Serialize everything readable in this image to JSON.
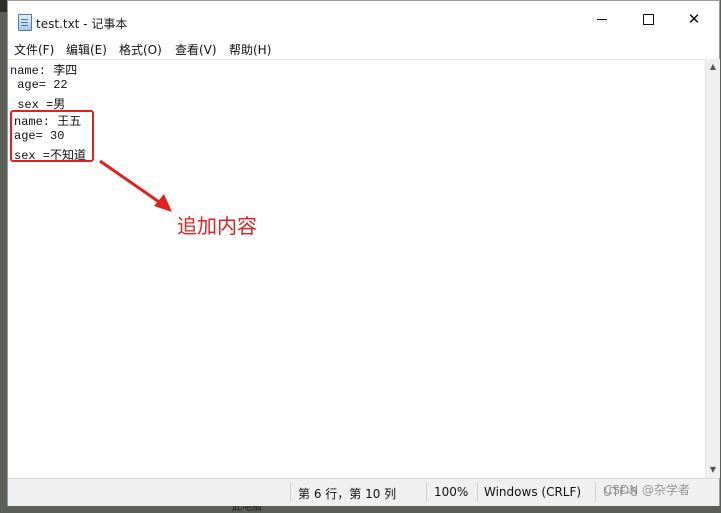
{
  "window": {
    "title": "test.txt - 记事本"
  },
  "menu": {
    "items": [
      "文件(F)",
      "编辑(E)",
      "格式(O)",
      "查看(V)",
      "帮助(H)"
    ]
  },
  "editor": {
    "lines": [
      "name: 李四",
      " age= 22",
      " sex =男",
      "name: 王五",
      "age= 30",
      "sex =不知道"
    ]
  },
  "annotation": {
    "label": "追加内容",
    "color": "#e12020"
  },
  "status": {
    "position": "第 6 行，第 10 列",
    "zoom": "100%",
    "line_ending": "Windows (CRLF)",
    "encoding": "UTF-8"
  },
  "watermark": {
    "text": "CSDN @杂学者"
  },
  "desktop": {
    "text": "此电脑"
  }
}
